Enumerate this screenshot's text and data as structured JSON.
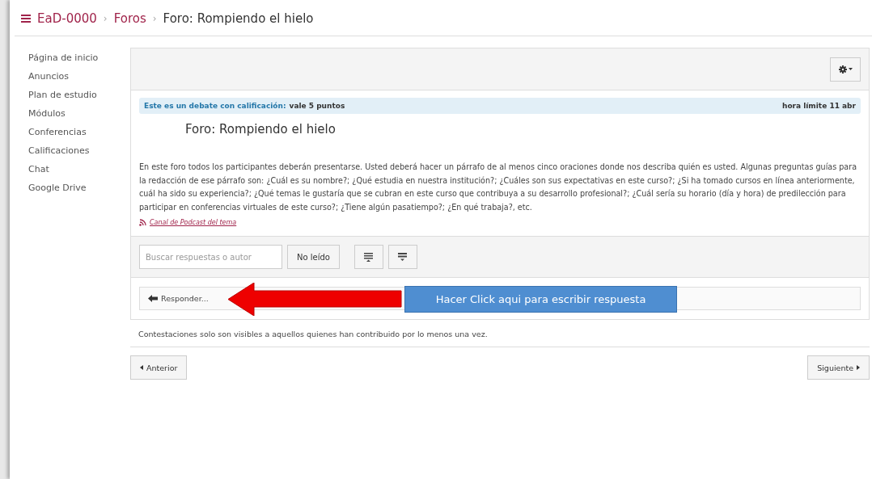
{
  "breadcrumb": {
    "separator": "›",
    "items": [
      {
        "label": "EaD-0000",
        "kind": "link"
      },
      {
        "label": "Foros",
        "kind": "link"
      },
      {
        "label": "Foro: Rompiendo el hielo",
        "kind": "current"
      }
    ]
  },
  "sidebar": {
    "items": [
      {
        "label": "Página de inicio"
      },
      {
        "label": "Anuncios"
      },
      {
        "label": "Plan de estudio"
      },
      {
        "label": "Módulos"
      },
      {
        "label": "Conferencias"
      },
      {
        "label": "Calificaciones"
      },
      {
        "label": "Chat"
      },
      {
        "label": "Google Drive"
      }
    ]
  },
  "topic": {
    "graded_label": "Este es un debate con calificación:",
    "points": "vale 5 puntos",
    "due": "hora límite 11 abr",
    "title": "Foro: Rompiendo el hielo",
    "body": "En este foro todos los participantes deberán presentarse. Usted deberá hacer un párrafo de al menos cinco oraciones donde nos describa quién es usted.  Algunas preguntas guías para la redacción de ese párrafo son:  ¿Cuál es su nombre?; ¿Qué estudia en nuestra institución?; ¿Cuáles son sus expectativas en este curso?; ¿Si ha tomado cursos en línea anteriormente, cuál ha sido su experiencia?; ¿Qué temas le gustaría que se cubran en este curso que contribuya a su desarrollo profesional?; ¿Cuál sería su horario (día  y hora) de predilección para participar en conferencias virtuales de este curso?; ¿Tiene algún pasatiempo?; ¿En qué trabaja?, etc.",
    "podcast": "Canal de Podcast del tema"
  },
  "toolbar": {
    "search": {
      "placeholder": "Buscar respuestas o autor"
    },
    "unread": "No leído"
  },
  "reply": {
    "label": "Responder...",
    "callout": "Hacer Click aqui para escribir respuesta"
  },
  "notice": "Contestaciones solo son visibles a aquellos quienes han contribuido por lo menos una vez.",
  "pager": {
    "previous": "Anterior",
    "next": "Siguiente"
  }
}
